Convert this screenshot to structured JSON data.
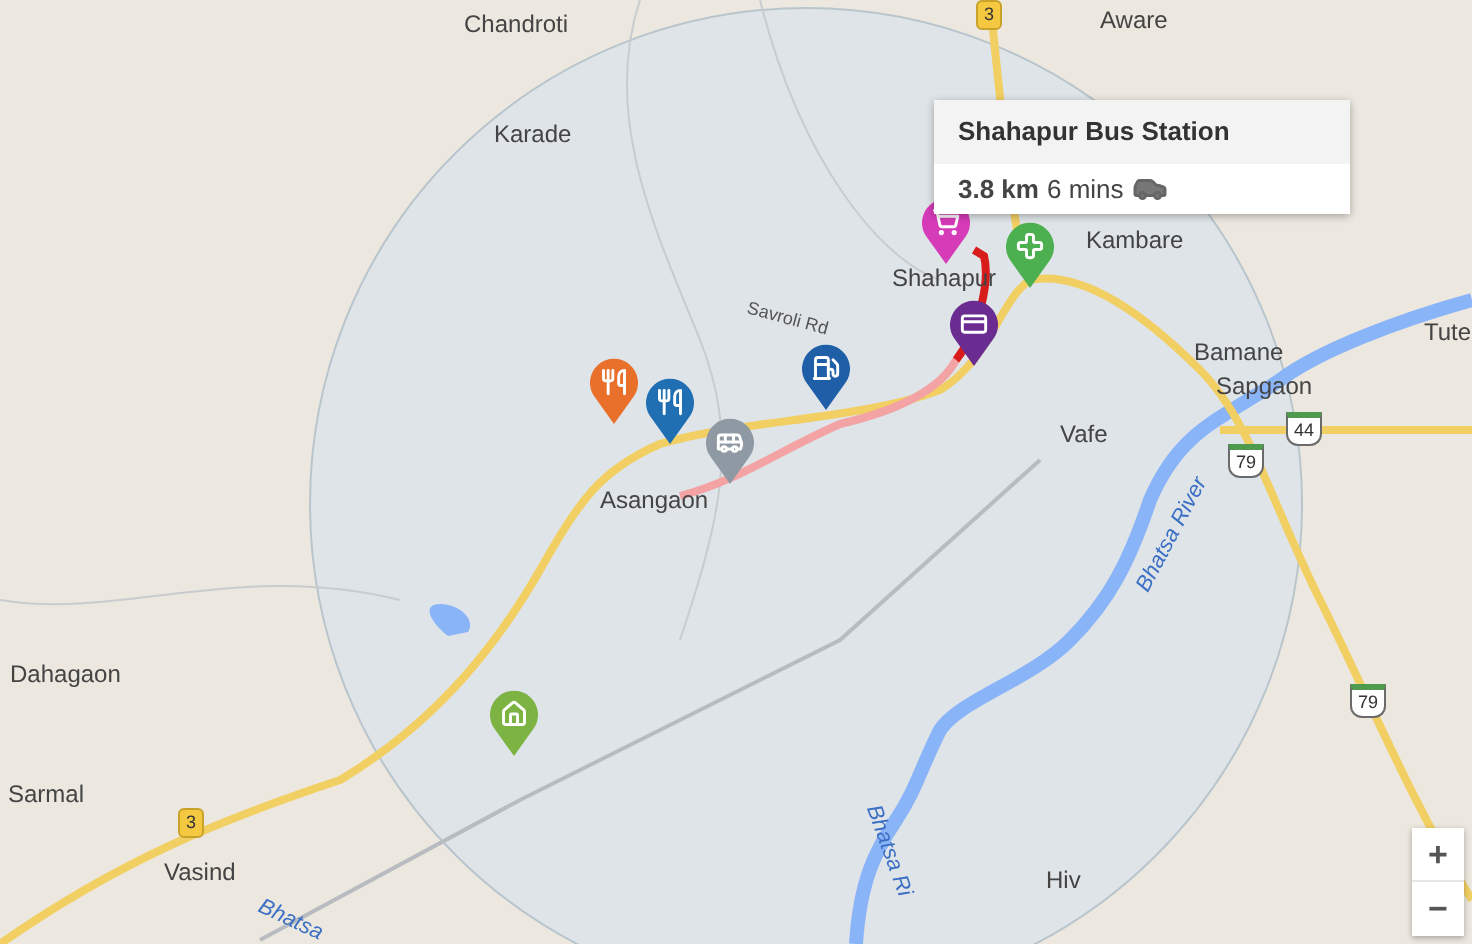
{
  "map": {
    "places": [
      {
        "kind": "town",
        "label": "Chandroti"
      },
      {
        "kind": "town",
        "label": "Aware"
      },
      {
        "kind": "town",
        "label": "Karade"
      },
      {
        "kind": "town",
        "label": "Kambare"
      },
      {
        "kind": "town",
        "label": "Shahapur"
      },
      {
        "kind": "town",
        "label": "Tute"
      },
      {
        "kind": "town",
        "label": "Bamane"
      },
      {
        "kind": "town",
        "label": "Sapgaon"
      },
      {
        "kind": "town",
        "label": "Vafe"
      },
      {
        "kind": "town",
        "label": "Asangaon"
      },
      {
        "kind": "town",
        "label": "Dahagaon"
      },
      {
        "kind": "town",
        "label": "Sarmal"
      },
      {
        "kind": "town",
        "label": "Vasind"
      },
      {
        "kind": "town",
        "label": "Hiv"
      },
      {
        "kind": "road",
        "label": "Savroli Rd"
      },
      {
        "kind": "river",
        "label": "Bhatsa River"
      },
      {
        "kind": "river",
        "label": "Bhatsa Ri"
      },
      {
        "kind": "river",
        "label": "Bhatsa"
      }
    ],
    "shields": [
      {
        "kind": "state",
        "label": "3"
      },
      {
        "kind": "state",
        "label": "3"
      },
      {
        "kind": "national",
        "label": "44"
      },
      {
        "kind": "national",
        "label": "79"
      },
      {
        "kind": "national",
        "label": "79"
      }
    ],
    "markers": [
      {
        "kind": "food",
        "color": "#e8702a"
      },
      {
        "kind": "food",
        "color": "#1f6fb2"
      },
      {
        "kind": "bus",
        "color": "#8f99a3"
      },
      {
        "kind": "fuel",
        "color": "#1f5fa8"
      },
      {
        "kind": "shop",
        "color": "#d63bb8"
      },
      {
        "kind": "atm",
        "color": "#6a2c91"
      },
      {
        "kind": "hospital",
        "color": "#4caf50"
      },
      {
        "kind": "home",
        "color": "#7cb342"
      }
    ],
    "popup": {
      "title": "Shahapur Bus Station",
      "distance": "3.8 km",
      "duration": "6 mins"
    },
    "zoom_controls": [
      "+",
      "−"
    ]
  }
}
